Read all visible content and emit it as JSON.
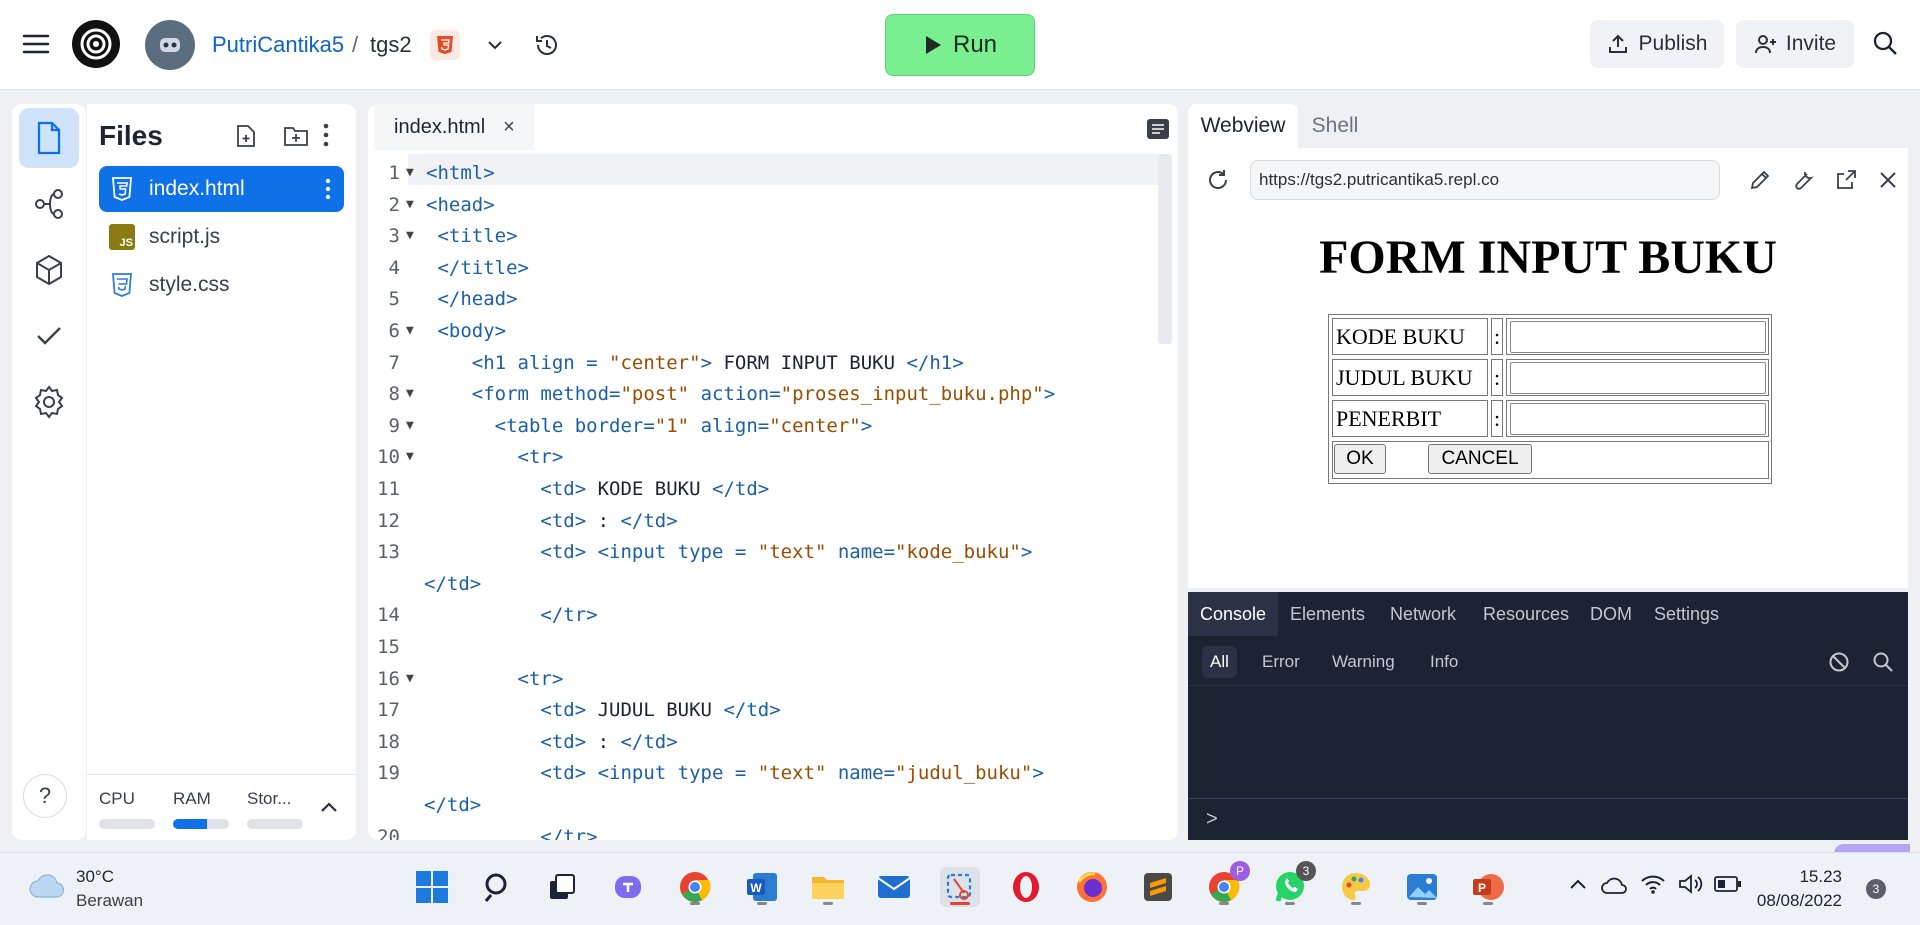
{
  "topbar": {
    "user": "PutriCantika5",
    "separator": "/",
    "repo": "tgs2",
    "run_label": "Run",
    "publish_label": "Publish",
    "invite_label": "Invite"
  },
  "sidebar": {
    "title": "Files",
    "files": [
      {
        "name": "index.html",
        "type": "html",
        "selected": true
      },
      {
        "name": "script.js",
        "type": "js",
        "selected": false
      },
      {
        "name": "style.css",
        "type": "css",
        "selected": false
      }
    ],
    "resources": [
      {
        "label": "CPU",
        "fill": 0
      },
      {
        "label": "RAM",
        "fill": 0.6
      },
      {
        "label": "Stor...",
        "fill": 0
      }
    ],
    "help_label": "?"
  },
  "editor": {
    "tab_name": "index.html",
    "tab_close": "×",
    "lines": [
      {
        "n": "1",
        "fold": true,
        "cont": false,
        "tokens": [
          [
            "k",
            "<html>"
          ]
        ]
      },
      {
        "n": "2",
        "fold": true,
        "cont": false,
        "tokens": [
          [
            "k",
            "<head>"
          ]
        ]
      },
      {
        "n": "3",
        "fold": true,
        "cont": false,
        "tokens": [
          [
            "p",
            " "
          ],
          [
            "k",
            "<title>"
          ]
        ]
      },
      {
        "n": "4",
        "fold": false,
        "cont": false,
        "tokens": [
          [
            "p",
            " "
          ],
          [
            "k",
            "</title>"
          ]
        ]
      },
      {
        "n": "5",
        "fold": false,
        "cont": false,
        "tokens": [
          [
            "p",
            " "
          ],
          [
            "k",
            "</head>"
          ]
        ]
      },
      {
        "n": "6",
        "fold": true,
        "cont": false,
        "tokens": [
          [
            "p",
            " "
          ],
          [
            "k",
            "<body>"
          ]
        ]
      },
      {
        "n": "7",
        "fold": false,
        "cont": false,
        "tokens": [
          [
            "p",
            "    "
          ],
          [
            "k",
            "<h1 align = "
          ],
          [
            "s",
            "\"center\""
          ],
          [
            "k",
            ">"
          ],
          [
            "p",
            " FORM INPUT BUKU "
          ],
          [
            "k",
            "</h1>"
          ]
        ]
      },
      {
        "n": "8",
        "fold": true,
        "cont": false,
        "tokens": [
          [
            "p",
            "    "
          ],
          [
            "k",
            "<form method="
          ],
          [
            "s",
            "\"post\""
          ],
          [
            "k",
            " action="
          ],
          [
            "s",
            "\"proses_input_buku.php\""
          ],
          [
            "k",
            ">"
          ]
        ]
      },
      {
        "n": "9",
        "fold": true,
        "cont": false,
        "tokens": [
          [
            "p",
            "      "
          ],
          [
            "k",
            "<table border="
          ],
          [
            "s",
            "\"1\""
          ],
          [
            "k",
            " align="
          ],
          [
            "s",
            "\"center\""
          ],
          [
            "k",
            ">"
          ]
        ]
      },
      {
        "n": "10",
        "fold": true,
        "cont": false,
        "tokens": [
          [
            "p",
            "        "
          ],
          [
            "k",
            "<tr>"
          ]
        ]
      },
      {
        "n": "11",
        "fold": false,
        "cont": false,
        "tokens": [
          [
            "p",
            "          "
          ],
          [
            "k",
            "<td>"
          ],
          [
            "p",
            " KODE BUKU "
          ],
          [
            "k",
            "</td>"
          ]
        ]
      },
      {
        "n": "12",
        "fold": false,
        "cont": false,
        "tokens": [
          [
            "p",
            "          "
          ],
          [
            "k",
            "<td>"
          ],
          [
            "p",
            " : "
          ],
          [
            "k",
            "</td>"
          ]
        ]
      },
      {
        "n": "13",
        "fold": false,
        "cont": false,
        "tokens": [
          [
            "p",
            "          "
          ],
          [
            "k",
            "<td>"
          ],
          [
            "p",
            " "
          ],
          [
            "k",
            "<input type = "
          ],
          [
            "s",
            "\"text\""
          ],
          [
            "k",
            " name="
          ],
          [
            "s",
            "\"kode_buku\""
          ],
          [
            "k",
            ">"
          ]
        ]
      },
      {
        "n": "",
        "fold": false,
        "cont": true,
        "tokens": [
          [
            "k",
            "</td>"
          ]
        ]
      },
      {
        "n": "14",
        "fold": false,
        "cont": false,
        "tokens": [
          [
            "p",
            "          "
          ],
          [
            "k",
            "</tr>"
          ]
        ]
      },
      {
        "n": "15",
        "fold": false,
        "cont": false,
        "tokens": [
          [
            "p",
            ""
          ]
        ]
      },
      {
        "n": "16",
        "fold": true,
        "cont": false,
        "tokens": [
          [
            "p",
            "        "
          ],
          [
            "k",
            "<tr>"
          ]
        ]
      },
      {
        "n": "17",
        "fold": false,
        "cont": false,
        "tokens": [
          [
            "p",
            "          "
          ],
          [
            "k",
            "<td>"
          ],
          [
            "p",
            " JUDUL BUKU "
          ],
          [
            "k",
            "</td>"
          ]
        ]
      },
      {
        "n": "18",
        "fold": false,
        "cont": false,
        "tokens": [
          [
            "p",
            "          "
          ],
          [
            "k",
            "<td>"
          ],
          [
            "p",
            " : "
          ],
          [
            "k",
            "</td>"
          ]
        ]
      },
      {
        "n": "19",
        "fold": false,
        "cont": false,
        "tokens": [
          [
            "p",
            "          "
          ],
          [
            "k",
            "<td>"
          ],
          [
            "p",
            " "
          ],
          [
            "k",
            "<input type = "
          ],
          [
            "s",
            "\"text\""
          ],
          [
            "k",
            " name="
          ],
          [
            "s",
            "\"judul_buku\""
          ],
          [
            "k",
            ">"
          ]
        ]
      },
      {
        "n": "",
        "fold": false,
        "cont": true,
        "tokens": [
          [
            "k",
            "</td>"
          ]
        ]
      },
      {
        "n": "20",
        "fold": false,
        "cont": false,
        "tokens": [
          [
            "p",
            "          "
          ],
          [
            "k",
            "</tr>"
          ]
        ]
      }
    ]
  },
  "webview": {
    "tabs": [
      "Webview",
      "Shell"
    ],
    "url": "https://tgs2.putricantika5.repl.co",
    "heading": "FORM INPUT BUKU",
    "rows": [
      {
        "label": "KODE BUKU",
        "sep": ":"
      },
      {
        "label": "JUDUL BUKU",
        "sep": ":"
      },
      {
        "label": "PENERBIT",
        "sep": ":"
      }
    ],
    "ok_label": "OK",
    "cancel_label": "CANCEL"
  },
  "console": {
    "tabs": [
      "Console",
      "Elements",
      "Network",
      "Resources",
      "DOM",
      "Settings"
    ],
    "filters": [
      "All",
      "Error",
      "Warning",
      "Info"
    ],
    "prompt": ">"
  },
  "taskbar": {
    "temp": "30°C",
    "weather": "Berawan",
    "time": "15.23",
    "date": "08/08/2022",
    "notif_count": "3",
    "chrome_profile": "P",
    "whatsapp_count": "3"
  },
  "colors": {
    "accent": "#0f71e8",
    "run_green": "#7aef8f",
    "console_bg": "#1c2333"
  }
}
